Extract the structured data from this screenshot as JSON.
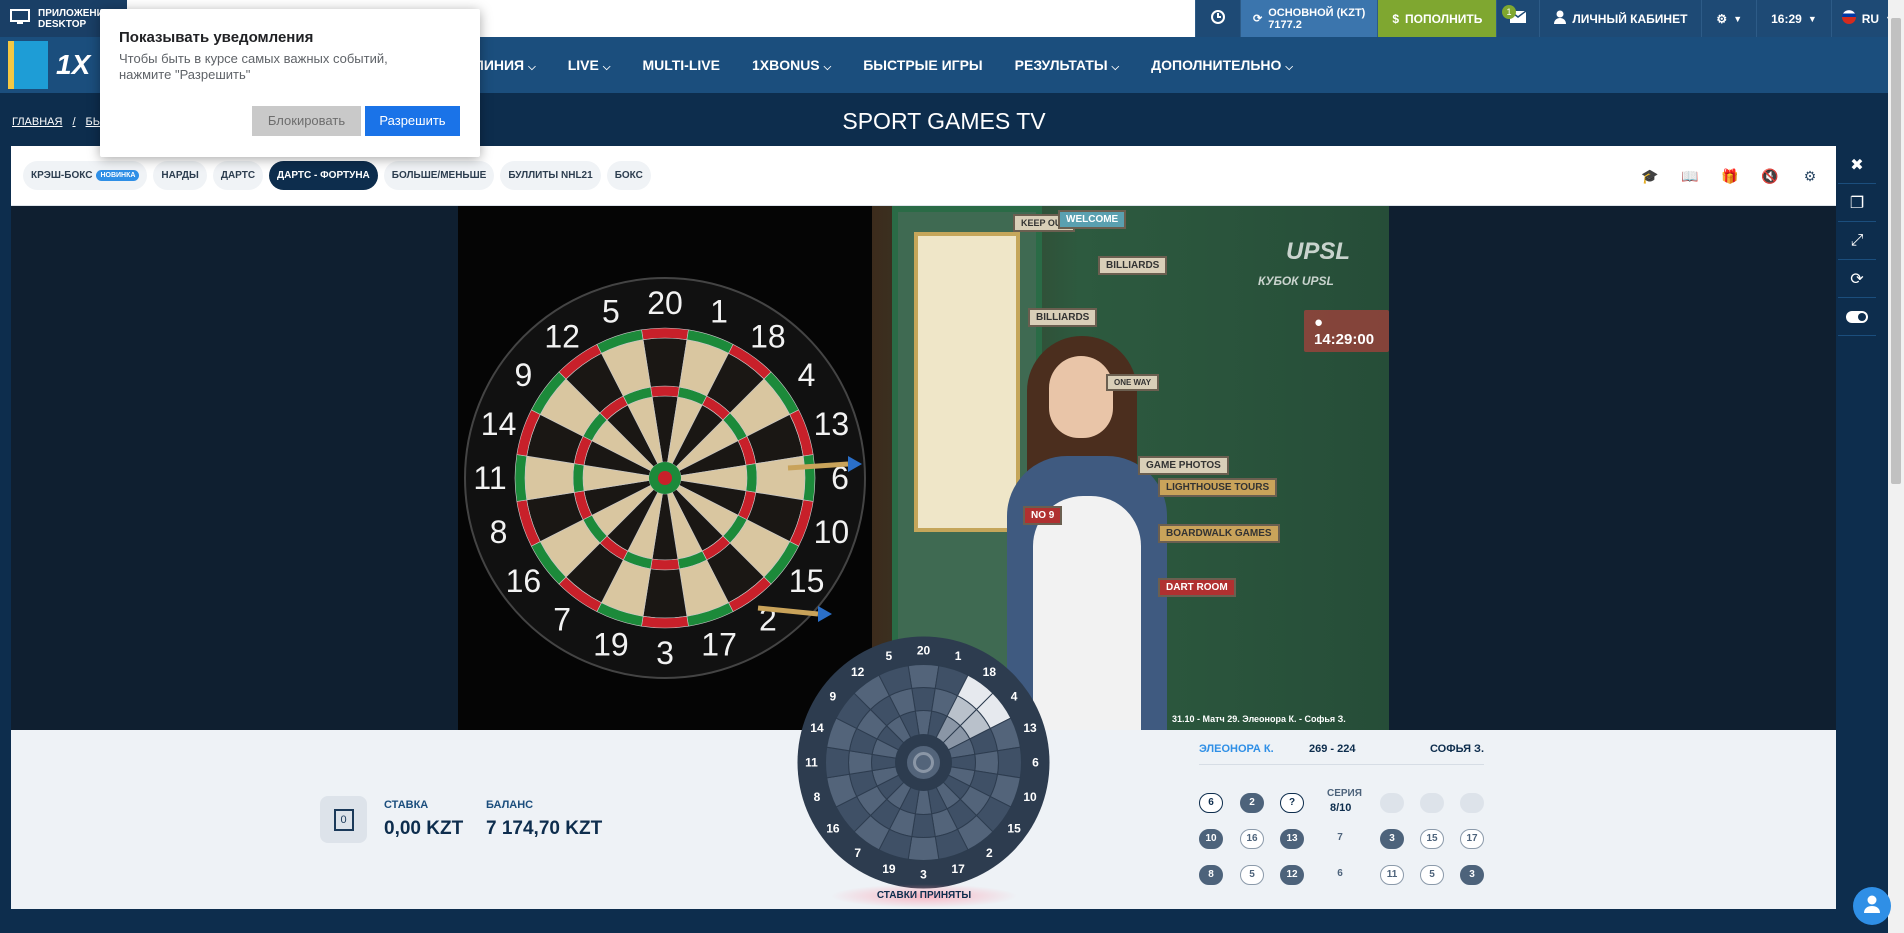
{
  "topbar": {
    "app_label_1": "ПРИЛОЖЕНИЕ",
    "app_label_2": "DESKTOP",
    "balance_label": "ОСНОВНОЙ (KZT)",
    "balance_value": "7177.2",
    "pay_label": "ПОПОЛНИТЬ",
    "mail_badge": "1",
    "cabinet_label": "ЛИЧНЫЙ КАБИНЕТ",
    "time": "16:29",
    "lang": "RU"
  },
  "nav": {
    "logo": "1X",
    "items": [
      {
        "label": "ЛИНИЯ",
        "chevron": true
      },
      {
        "label": "LIVE",
        "chevron": true
      },
      {
        "label": "MULTI-LIVE",
        "chevron": false
      },
      {
        "label": "1XBONUS",
        "chevron": true
      },
      {
        "label": "БЫСТРЫЕ ИГРЫ",
        "chevron": false
      },
      {
        "label": "РЕЗУЛЬТАТЫ",
        "chevron": true
      },
      {
        "label": "ДОПОЛНИТЕЛЬНО",
        "chevron": true
      }
    ]
  },
  "breadcrumb": {
    "home": "ГЛАВНАЯ",
    "sep": "/",
    "next": "БЫ"
  },
  "page_title": "SPORT GAMES TV",
  "tabs": [
    {
      "label": "КРЭШ-БОКС",
      "badge": "НОВИНКА",
      "active": false
    },
    {
      "label": "НАРДЫ",
      "active": false
    },
    {
      "label": "ДАРТС",
      "active": false
    },
    {
      "label": "ДАРТС - ФОРТУНА",
      "active": true
    },
    {
      "label": "БОЛЬШЕ/МЕНЬШЕ",
      "active": false
    },
    {
      "label": "БУЛЛИТЫ NHL21",
      "active": false
    },
    {
      "label": "БОКС",
      "active": false
    }
  ],
  "video": {
    "overlay_logo": "UPSL",
    "overlay_sub": "КУБОК UPSL",
    "clock": "14:29:00",
    "caption": "31.10 - Матч 29. Элеонора К. - Софья З.",
    "signs": [
      "KEEP OUT",
      "WELCOME",
      "BILLIARDS",
      "BILLIARDS",
      "ONE WAY",
      "GAME PHOTOS",
      "LIGHTHOUSE TOURS",
      "NO 9",
      "BOARDWALK GAMES",
      "DART ROOM"
    ]
  },
  "bet": {
    "icon_value": "0",
    "stake_label": "СТАВКА",
    "stake_value": "0,00 KZT",
    "balance_label": "БАЛАНС",
    "balance_value": "7 174,70 KZT"
  },
  "wheel": {
    "numbers": [
      "20",
      "1",
      "18",
      "4",
      "13",
      "6",
      "10",
      "15",
      "2",
      "17",
      "3",
      "19",
      "7",
      "16",
      "8",
      "11",
      "14",
      "9",
      "12",
      "5"
    ],
    "status": "СТАВКИ ПРИНЯТЫ"
  },
  "scoreboard": {
    "player1": "ЭЛЕОНОРА К.",
    "score": "269  -  224",
    "player2": "СОФЬЯ З.",
    "series_label": "СЕРИЯ",
    "series_value": "8/10",
    "rows": [
      [
        {
          "v": "6",
          "s": "o"
        },
        {
          "v": "2",
          "s": "f"
        },
        {
          "v": "?",
          "s": "o"
        }
      ],
      [
        {
          "v": "10",
          "s": "f"
        },
        {
          "v": "16",
          "s": "g"
        },
        {
          "v": "13",
          "s": "f"
        },
        {
          "v": "7",
          "s": "t"
        },
        {
          "v": "3",
          "s": "f"
        },
        {
          "v": "15",
          "s": "g"
        },
        {
          "v": "17",
          "s": "g"
        }
      ],
      [
        {
          "v": "8",
          "s": "f"
        },
        {
          "v": "5",
          "s": "g"
        },
        {
          "v": "12",
          "s": "f"
        },
        {
          "v": "6",
          "s": "t"
        },
        {
          "v": "11",
          "s": "g"
        },
        {
          "v": "5",
          "s": "g"
        },
        {
          "v": "3",
          "s": "f"
        }
      ]
    ]
  },
  "popup": {
    "title": "Показывать уведомления",
    "text": "Чтобы быть в курсе самых важных событий, нажмите \"Разрешить\"",
    "block": "Блокировать",
    "allow": "Разрешить"
  }
}
